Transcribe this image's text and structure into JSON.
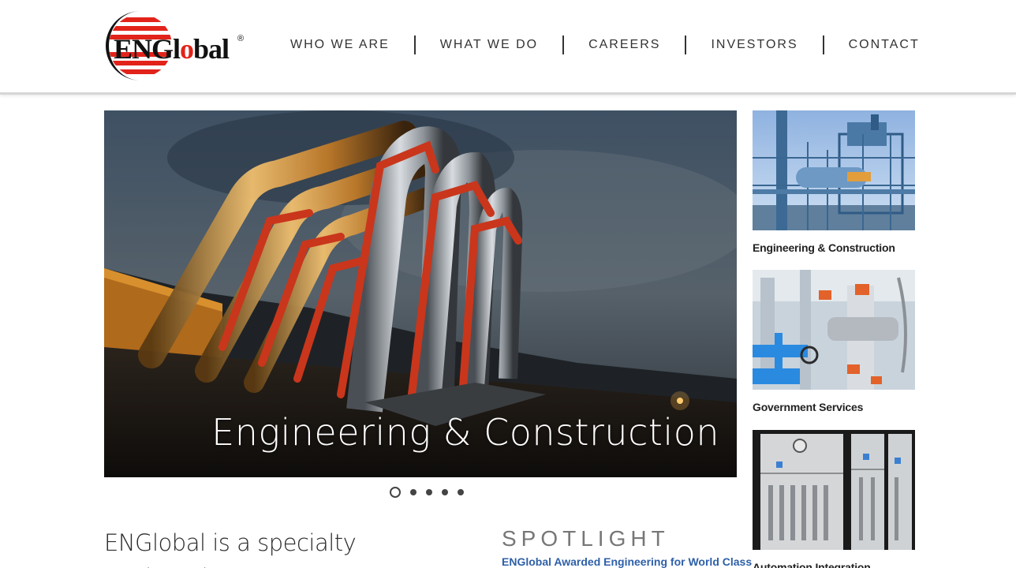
{
  "brand": {
    "logo_text": "ENGlobal",
    "registered": "®",
    "accent": "#e2231a",
    "dark": "#111111"
  },
  "nav": {
    "items": [
      {
        "label": "WHO WE ARE"
      },
      {
        "label": "WHAT WE DO"
      },
      {
        "label": "CAREERS"
      },
      {
        "label": "INVESTORS"
      },
      {
        "label": "CONTACT"
      }
    ]
  },
  "hero": {
    "caption": "Engineering & Construction",
    "slides_total": 5,
    "active_slide": 1
  },
  "tiles": [
    {
      "label": "Engineering & Construction",
      "icon": "industrial-structure-photo"
    },
    {
      "label": "Government Services",
      "icon": "valves-piping-photo"
    },
    {
      "label": "Automation Integration",
      "icon": "control-panel-photo"
    }
  ],
  "intro": {
    "text": "ENGlobal is a specialty engineering"
  },
  "spotlight": {
    "title": "SPOTLIGHT",
    "headline": "ENGlobal Awarded Engineering for World Class"
  },
  "colors": {
    "link": "#2e5fa8",
    "nav_text": "#333333"
  }
}
